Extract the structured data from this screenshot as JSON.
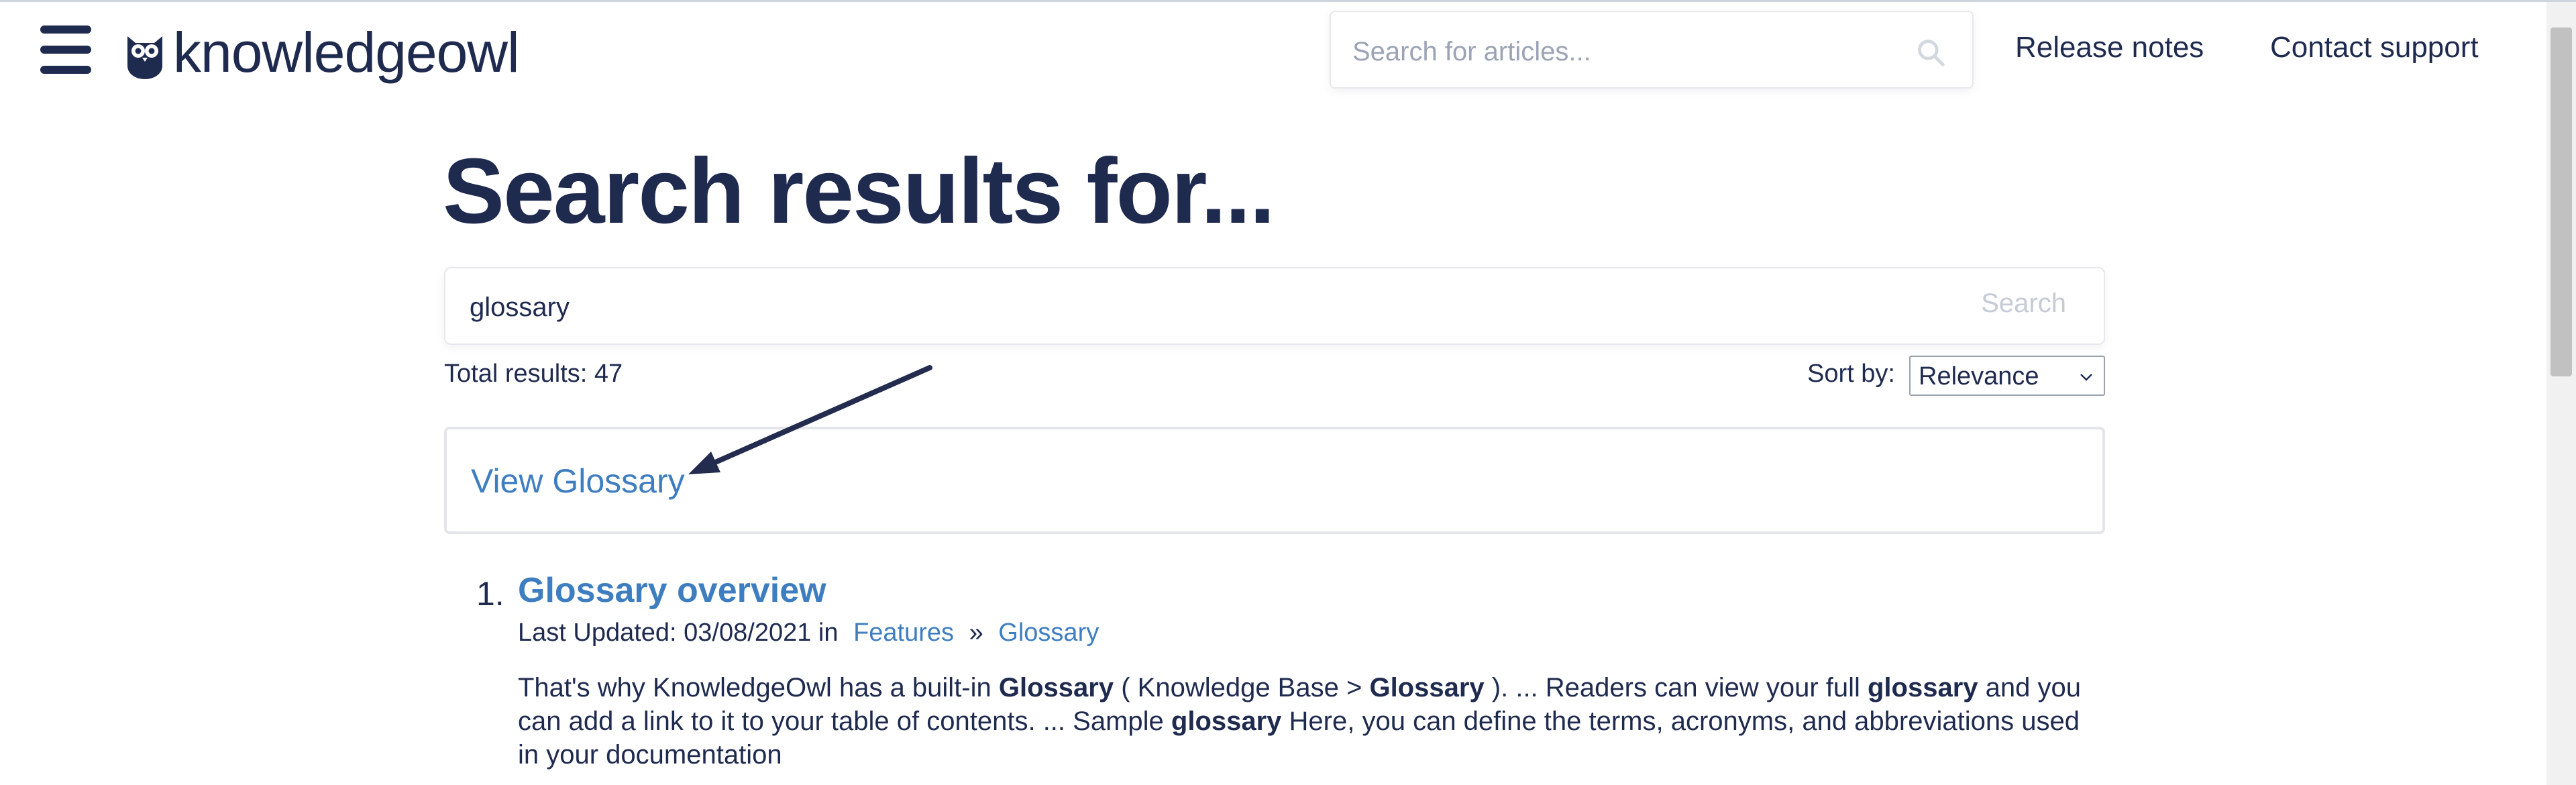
{
  "header": {
    "logo_text": "knowledgeowl",
    "search_placeholder": "Search for articles...",
    "nav": [
      "Release notes",
      "Contact support"
    ]
  },
  "main": {
    "title": "Search results for...",
    "search_value": "glossary",
    "search_button": "Search",
    "total_results": "Total results: 47",
    "sort_label": "Sort by:",
    "sort_value": "Relevance",
    "glossary_link": "View Glossary"
  },
  "results": [
    {
      "number": "1.",
      "title": "Glossary overview",
      "meta_prefix": "Last Updated: 03/08/2021 in",
      "category": "Features",
      "separator": "»",
      "subcategory": "Glossary",
      "snippet_parts": [
        {
          "text": "That's why KnowledgeOwl has a built-in ",
          "bold": false
        },
        {
          "text": "Glossary",
          "bold": true
        },
        {
          "text": " ( Knowledge Base > ",
          "bold": false
        },
        {
          "text": "Glossary",
          "bold": true
        },
        {
          "text": " ). ... Readers can view your full ",
          "bold": false
        },
        {
          "text": "glossary",
          "bold": true
        },
        {
          "text": " and you can add a link to it to your table of contents. ... Sample ",
          "bold": false
        },
        {
          "text": "glossary",
          "bold": true
        },
        {
          "text": " Here, you can define the terms, acronyms, and abbreviations used in your documentation",
          "bold": false
        }
      ]
    }
  ],
  "icons": {
    "menu": "hamburger-menu-icon",
    "logo": "owl-logo-icon",
    "search": "search-icon",
    "sort": "chevron-down-icon",
    "annotation": "annotation-arrow"
  },
  "colors": {
    "primary_text": "#1f2a4f",
    "link": "#3e7ec0",
    "placeholder": "#9ba3b4",
    "annotation_arrow": "#232c4e"
  }
}
